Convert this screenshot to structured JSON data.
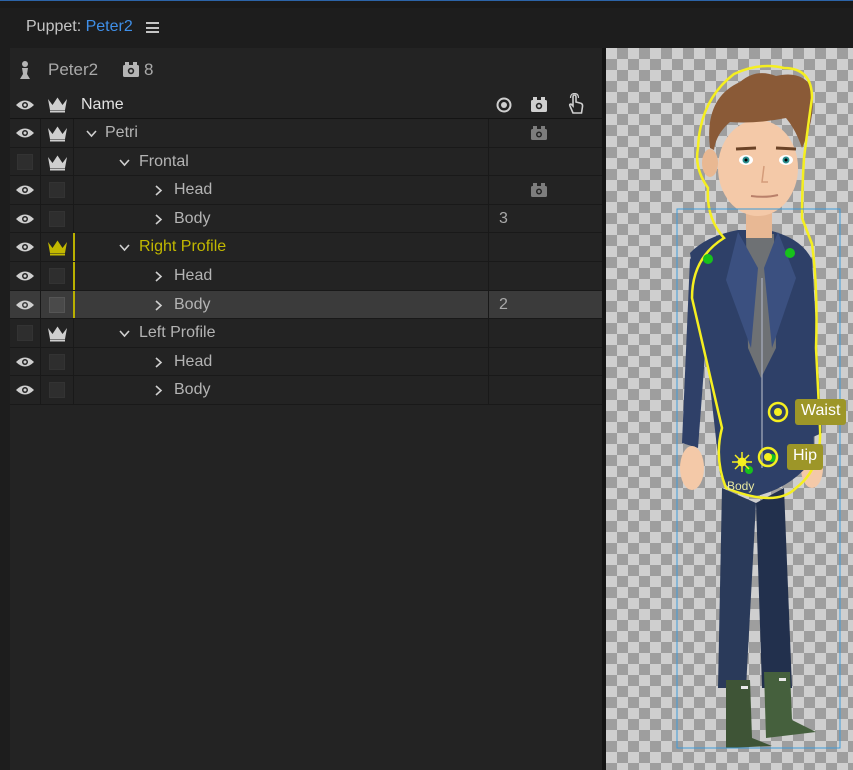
{
  "tab": {
    "prefix": "Puppet: ",
    "puppet_name": "Peter2"
  },
  "header": {
    "puppet_name": "Peter2",
    "count": "8"
  },
  "columns": {
    "name": "Name"
  },
  "rows": [
    {
      "label": "Petri",
      "value": ""
    },
    {
      "label": "Frontal",
      "value": ""
    },
    {
      "label": "Head",
      "value": ""
    },
    {
      "label": "Body",
      "value": "3"
    },
    {
      "label": "Right Profile",
      "value": ""
    },
    {
      "label": "Head",
      "value": ""
    },
    {
      "label": "Body",
      "value": "2"
    },
    {
      "label": "Left Profile",
      "value": ""
    },
    {
      "label": "Head",
      "value": ""
    },
    {
      "label": "Body",
      "value": ""
    }
  ],
  "stage": {
    "waist_tag": "Waist",
    "hip_tag": "Hip",
    "body_label": "Body"
  },
  "colors": {
    "accent": "#3f8fe8",
    "highlight": "#c2b800",
    "selection": "#3b3b3b"
  }
}
